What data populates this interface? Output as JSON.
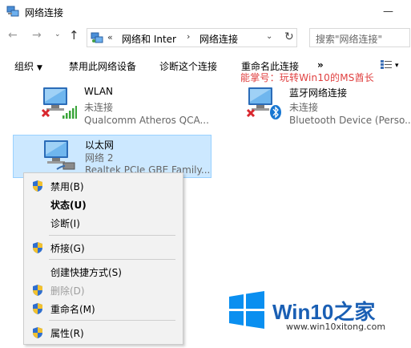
{
  "window": {
    "title": "网络连接",
    "minimize_glyph": "—"
  },
  "nav": {
    "back_glyph": "←",
    "forward_glyph": "→",
    "recent_glyph": "⌄",
    "up_glyph": "↑",
    "address": {
      "overflow": "«",
      "segment1": "网络和 Inter",
      "separator": "›",
      "segment2": "网络连接",
      "dropdown_glyph": "⌄",
      "refresh_glyph": "↻"
    },
    "search_placeholder": "搜索\"网络连接\""
  },
  "commands": {
    "organize": "组织",
    "organize_drop": "▼",
    "disable": "禁用此网络设备",
    "diagnose": "诊断这个连接",
    "rename": "重命名此连接",
    "more": "»",
    "view_drop": "▾"
  },
  "watermark_top": "能掌号：玩转Win10的MS酋长",
  "connections": [
    {
      "name": "WLAN",
      "status": "未连接",
      "device": "Qualcomm Atheros QCA..."
    },
    {
      "name": "蓝牙网络连接",
      "status": "未连接",
      "device": "Bluetooth Device (Perso..."
    },
    {
      "name": "以太网",
      "status": "网络  2",
      "device": "Realtek PCIe GBE Family..."
    }
  ],
  "context_menu": [
    {
      "label": "禁用(B)",
      "shield": true
    },
    {
      "label": "状态(U)",
      "bold": true
    },
    {
      "label": "诊断(I)"
    },
    {
      "label": "桥接(G)",
      "shield": true
    },
    {
      "label": "创建快捷方式(S)"
    },
    {
      "label": "删除(D)",
      "shield": true,
      "disabled": true
    },
    {
      "label": "重命名(M)",
      "shield": true
    },
    {
      "label": "属性(R)",
      "shield": true
    }
  ],
  "logo": {
    "brand": "Win10",
    "suffix": "之家",
    "url": "www.win10xitong.com"
  },
  "colors": {
    "selection_bg": "#cce8ff",
    "selection_border": "#99d1ff",
    "watermark_red": "#e04040",
    "logo_blue": "#1a5fb4",
    "wifi_green": "#3aa53a",
    "bluetooth_blue": "#1877d2",
    "error_red": "#d9272e"
  }
}
